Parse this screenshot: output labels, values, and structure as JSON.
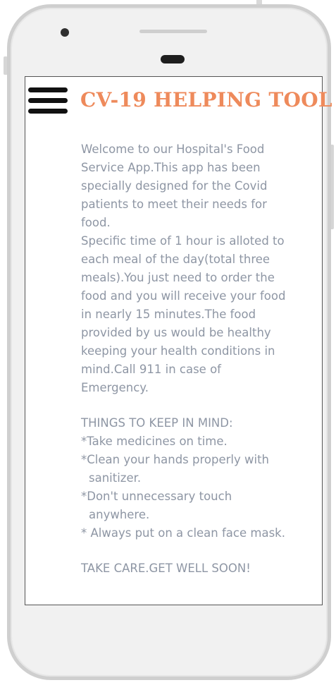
{
  "app": {
    "title": "CV-19 HELPING TOOL",
    "menu_icon": "hamburger-menu-icon",
    "title_color": "#ee8a5b",
    "text_color": "#8e96a4"
  },
  "welcome": {
    "line1": "Welcome to our Hospital's Food",
    "line2": "Service App.This app has been",
    "line3": "specially designed for the Covid",
    "line4": "patients to meet their needs for",
    "line5": "food."
  },
  "info": {
    "line1": "Specific time of 1 hour is alloted to",
    "line2": "each meal of the day(total three",
    "line3": "meals).You just need to order the",
    "line4": "food and you will receive your food",
    "line5": "in nearly 15 minutes.The food",
    "line6": "provided by us would be healthy",
    "line7": "keeping your health conditions in",
    "line8": "mind.Call 911 in case of",
    "line9": "Emergency."
  },
  "tips": {
    "heading": "THINGS TO KEEP IN MIND:",
    "tip1": "*Take medicines on time.",
    "tip2_line1": "*Clean your hands properly with",
    "tip2_line2": "sanitizer.",
    "tip3_line1": "*Don't unnecessary touch",
    "tip3_line2": "anywhere.",
    "tip4": "* Always put on a clean face mask."
  },
  "closing": "TAKE CARE.GET WELL SOON!"
}
